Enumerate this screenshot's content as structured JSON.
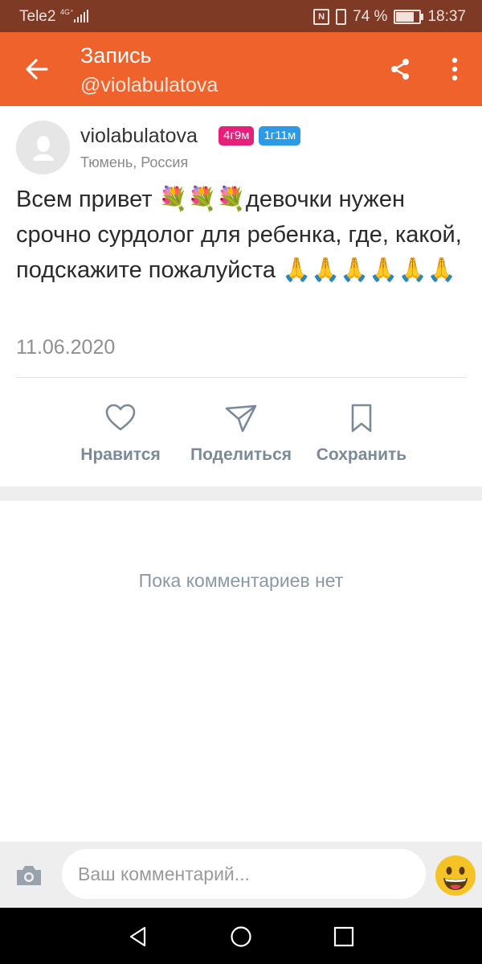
{
  "status_bar": {
    "carrier": "Tele2",
    "network": "4G⁺",
    "battery_percent": "74 %",
    "time": "18:37"
  },
  "header": {
    "title": "Запись",
    "subtitle": "@violabulatova",
    "color": "#f0622b"
  },
  "post": {
    "author": "violabulatova",
    "badges": [
      "4г9м",
      "1г11м"
    ],
    "location": "Тюмень, Россия",
    "text": "Всем привет 💐💐💐девочки нужен срочно сурдолог для ребенка, где, какой, подскажите пожалуйста 🙏🙏🙏🙏🙏🙏",
    "date": "11.06.2020"
  },
  "actions": {
    "like": "Нравится",
    "share": "Поделиться",
    "save": "Сохранить"
  },
  "comments": {
    "empty_text": "Пока комментариев нет"
  },
  "comment_bar": {
    "placeholder": "Ваш комментарий..."
  }
}
